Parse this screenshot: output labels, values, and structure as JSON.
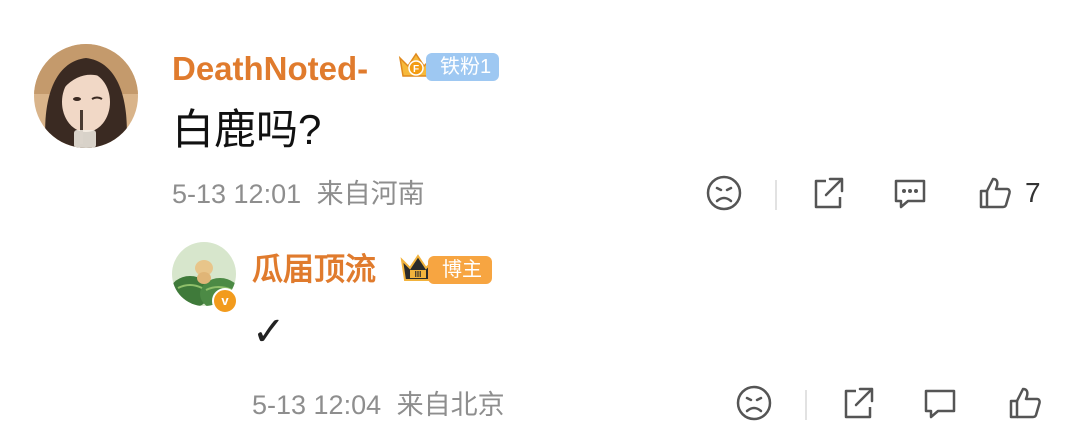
{
  "comment": {
    "username": "DeathNoted-",
    "fan_badge": "铁粉1",
    "text": "白鹿吗?",
    "time": "5-13 12:01",
    "location": "来自河南",
    "like_count": "7"
  },
  "reply": {
    "username": "瓜届顶流",
    "role_badge": "博主",
    "text": "✓",
    "time": "5-13 12:04",
    "location": "来自北京"
  },
  "colors": {
    "username": "#e07b2d",
    "fan_badge": "#9ec8f2",
    "blogger_badge": "#f7a541",
    "meta_text": "#8e8e8e",
    "icon": "#555555"
  },
  "icons": {
    "sad_face": "frown-icon",
    "share": "share-icon",
    "comment": "comment-icon",
    "like": "thumbs-up-icon",
    "crown": "crown-icon",
    "verified": "verified-icon"
  }
}
